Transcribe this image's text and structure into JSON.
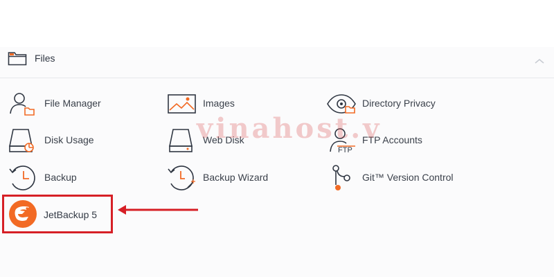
{
  "section": {
    "title": "Files"
  },
  "items": [
    {
      "label": "File Manager",
      "icon": "user-folder-icon"
    },
    {
      "label": "Images",
      "icon": "image-icon"
    },
    {
      "label": "Directory Privacy",
      "icon": "eye-folder-icon"
    },
    {
      "label": "Disk Usage",
      "icon": "disk-usage-icon"
    },
    {
      "label": "Web Disk",
      "icon": "web-disk-icon"
    },
    {
      "label": "FTP Accounts",
      "icon": "ftp-icon"
    },
    {
      "label": "Backup",
      "icon": "clock-icon"
    },
    {
      "label": "Backup Wizard",
      "icon": "clock-wand-icon"
    },
    {
      "label": "Git™ Version Control",
      "icon": "git-branch-icon"
    },
    {
      "label": "JetBackup 5",
      "icon": "jetbackup-logo"
    }
  ],
  "watermark": "vinahost.v",
  "colors": {
    "accent_orange": "#f26a24",
    "icon_stroke": "#2f3642",
    "highlight_red": "#d61f26"
  }
}
